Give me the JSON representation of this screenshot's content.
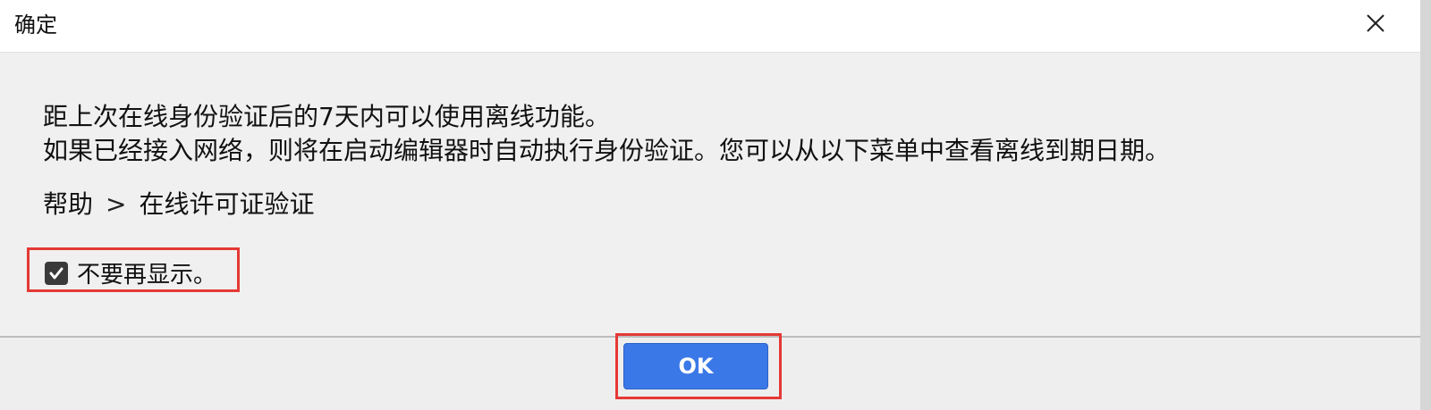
{
  "window": {
    "title": "确定",
    "close_icon": "close-icon"
  },
  "message": {
    "line1": "距上次在线身份验证后的7天内可以使用离线功能。",
    "line2": "如果已经接入网络，则将在启动编辑器时自动执行身份验证。您可以从以下菜单中查看离线到期日期。"
  },
  "menu_path": {
    "parent": "帮助",
    "separator": ">",
    "child": "在线许可证验证"
  },
  "checkbox": {
    "label": "不要再显示。",
    "checked": true
  },
  "footer": {
    "ok_label": "OK"
  },
  "colors": {
    "accent": "#3b78e7",
    "highlight": "#e53935"
  }
}
